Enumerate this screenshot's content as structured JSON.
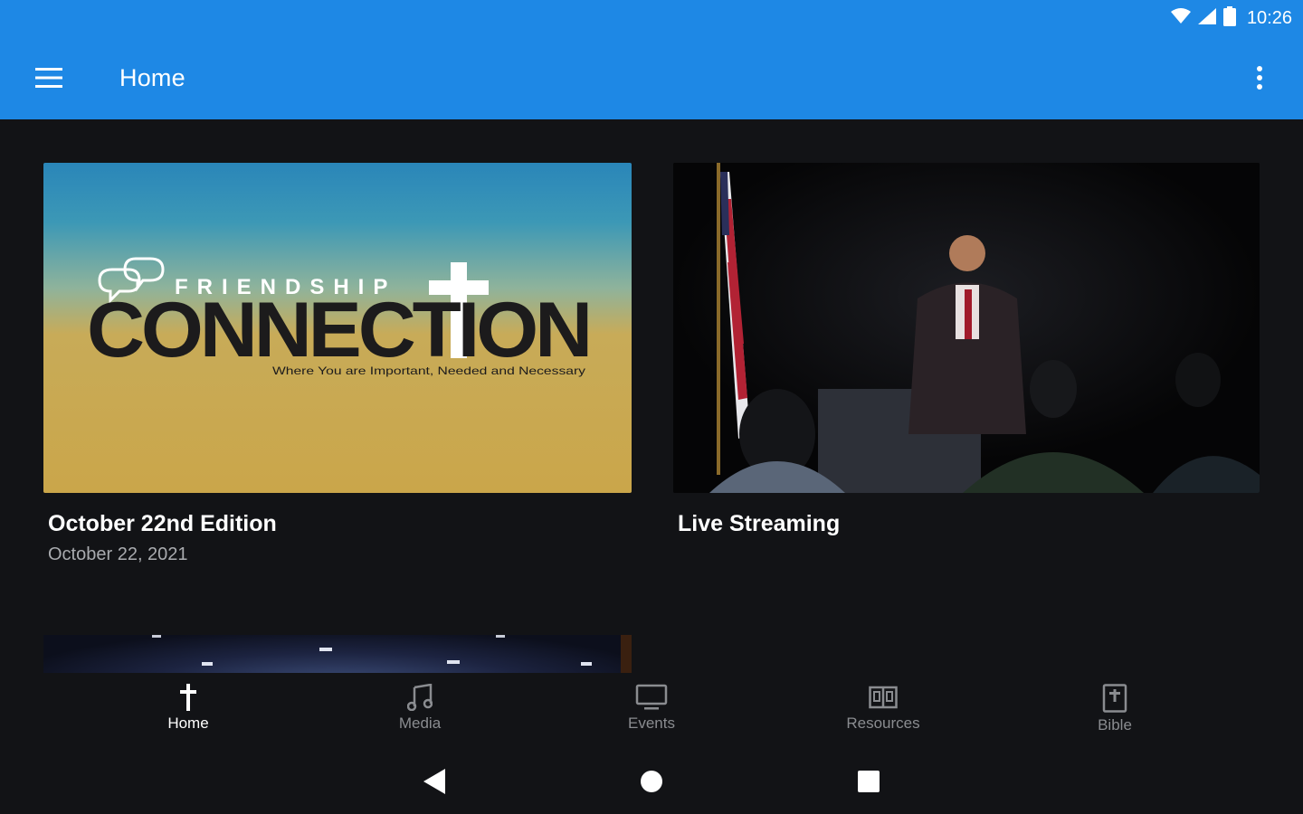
{
  "status_bar": {
    "time": "10:26"
  },
  "app_bar": {
    "title": "Home"
  },
  "cards": [
    {
      "title": "October 22nd Edition",
      "subtitle": "October 22, 2021",
      "image": {
        "brand_top": "FRIENDSHIP",
        "brand_main": "CONNECTION",
        "tagline": "Where You are Important, Needed and Necessary"
      }
    },
    {
      "title": "Live Streaming",
      "subtitle": ""
    }
  ],
  "bottom_nav": {
    "items": [
      {
        "label": "Home",
        "icon": "cross-icon",
        "active": true
      },
      {
        "label": "Media",
        "icon": "music-note-icon",
        "active": false
      },
      {
        "label": "Events",
        "icon": "monitor-icon",
        "active": false
      },
      {
        "label": "Resources",
        "icon": "book-open-icon",
        "active": false
      },
      {
        "label": "Bible",
        "icon": "bible-icon",
        "active": false
      }
    ]
  },
  "colors": {
    "primary": "#1e88e5",
    "background": "#121316",
    "muted_text": "#a9abaf"
  }
}
